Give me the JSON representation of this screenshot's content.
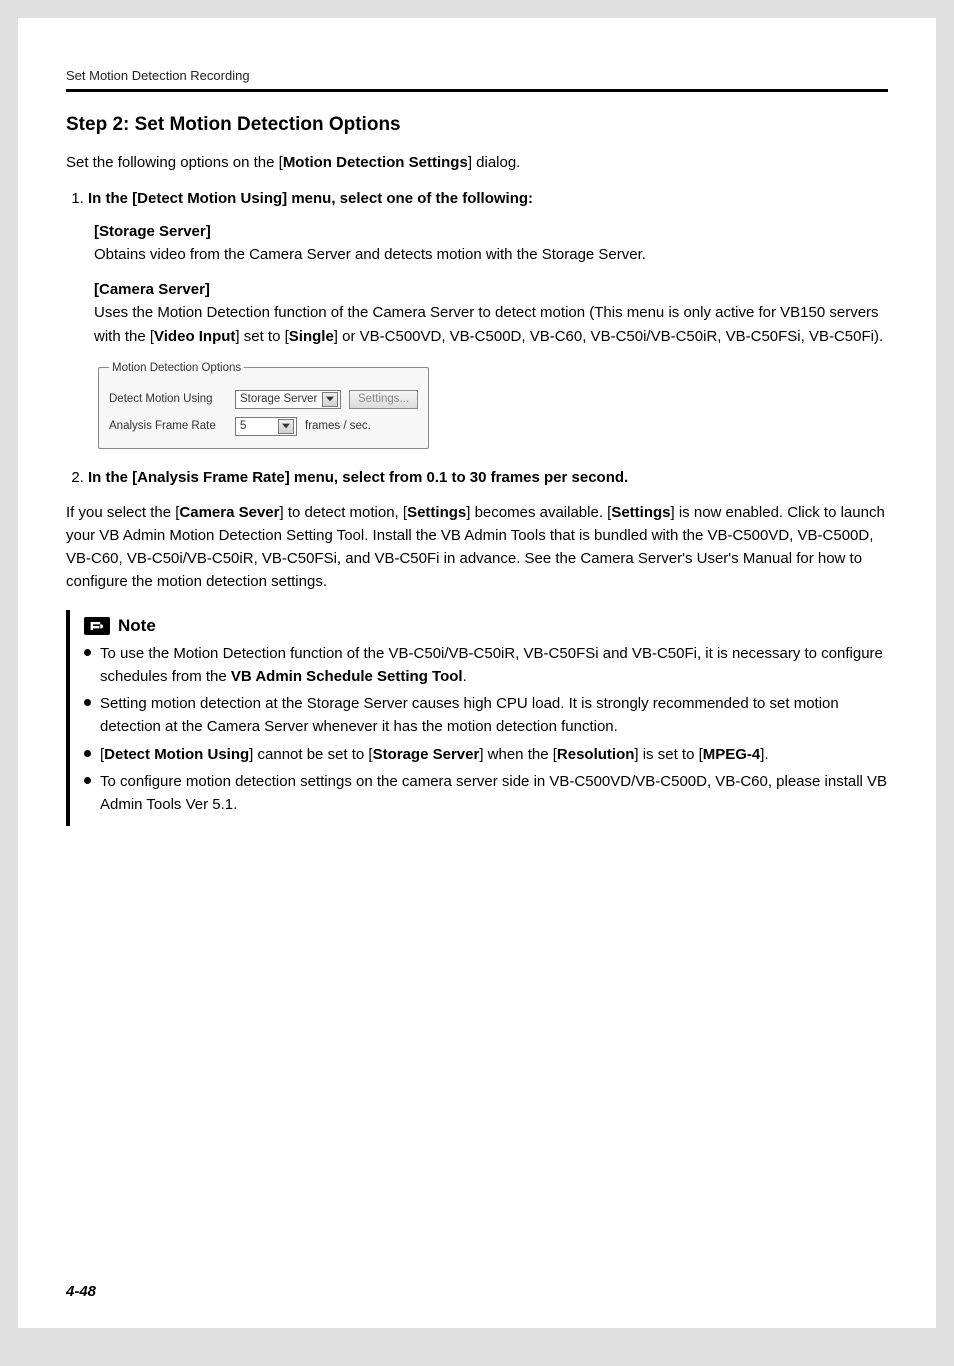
{
  "header": {
    "running_head": "Set Motion Detection Recording"
  },
  "step": {
    "title": "Step 2: Set Motion Detection Options",
    "intro_pre": "Set the following options on the [",
    "intro_bold": "Motion Detection Settings",
    "intro_post": "] dialog."
  },
  "list1": {
    "item1_pre": "In the [",
    "item1_bold": "Detect Motion Using",
    "item1_post": "] menu, select one of the following:"
  },
  "sub_storage": {
    "head": "[Storage Server]",
    "body": "Obtains video from the Camera Server and detects motion with the Storage Server."
  },
  "sub_camera": {
    "head": "[Camera Server]",
    "body_pre": "Uses the Motion Detection function of the Camera Server to detect motion (This menu is only active for VB150 servers with the [",
    "body_b1": "Video Input",
    "body_mid": "] set to [",
    "body_b2": "Single",
    "body_post": "] or VB-C500VD, VB-C500D, VB-C60, VB-C50i/VB-C50iR, VB-C50FSi, VB-C50Fi)."
  },
  "panel": {
    "legend": "Motion Detection Options",
    "row1_label": "Detect Motion Using",
    "row1_value": "Storage Server",
    "row1_button": "Settings...",
    "row2_label": "Analysis Frame Rate",
    "row2_value": "5",
    "row2_unit": "frames / sec."
  },
  "list2": {
    "item2_pre": "In the [",
    "item2_bold": "Analysis Frame Rate",
    "item2_post": "] menu, select from 0.1 to 30 frames per second."
  },
  "para": {
    "t1": "If you select the [",
    "b1": "Camera Sever",
    "t2": "] to detect motion, [",
    "b2": "Settings",
    "t3": "] becomes available. [",
    "b3": "Settings",
    "t4": "] is now enabled. Click to launch your VB Admin Motion Detection Setting Tool. Install the VB Admin Tools that is bundled with the VB-C500VD, VB-C500D, VB-C60, VB-C50i/VB-C50iR, VB-C50FSi, and VB-C50Fi in advance. See the Camera Server's User's Manual for how to configure the motion detection settings."
  },
  "note": {
    "title": "Note",
    "items": [
      {
        "t1": "To use the Motion Detection function of the VB-C50i/VB-C50iR, VB-C50FSi and VB-C50Fi, it is necessary to configure schedules from the ",
        "b1": "VB Admin Schedule Setting Tool",
        "t2": "."
      },
      {
        "t1": "Setting motion detection at the Storage Server causes high CPU load. It is strongly recommended to set motion detection at the Camera Server whenever it has the motion detection function."
      },
      {
        "t1": "[",
        "b1": "Detect Motion Using",
        "t2": "] cannot be set to [",
        "b2": "Storage Server",
        "t3": "] when the [",
        "b3": "Resolution",
        "t4": "] is set to [",
        "b4": "MPEG-4",
        "t5": "]."
      },
      {
        "t1": "To configure motion detection settings on the camera server side in VB-C500VD/VB-C500D, VB-C60, please install VB Admin Tools Ver 5.1."
      }
    ]
  },
  "footer": {
    "page_number": "4-48"
  }
}
